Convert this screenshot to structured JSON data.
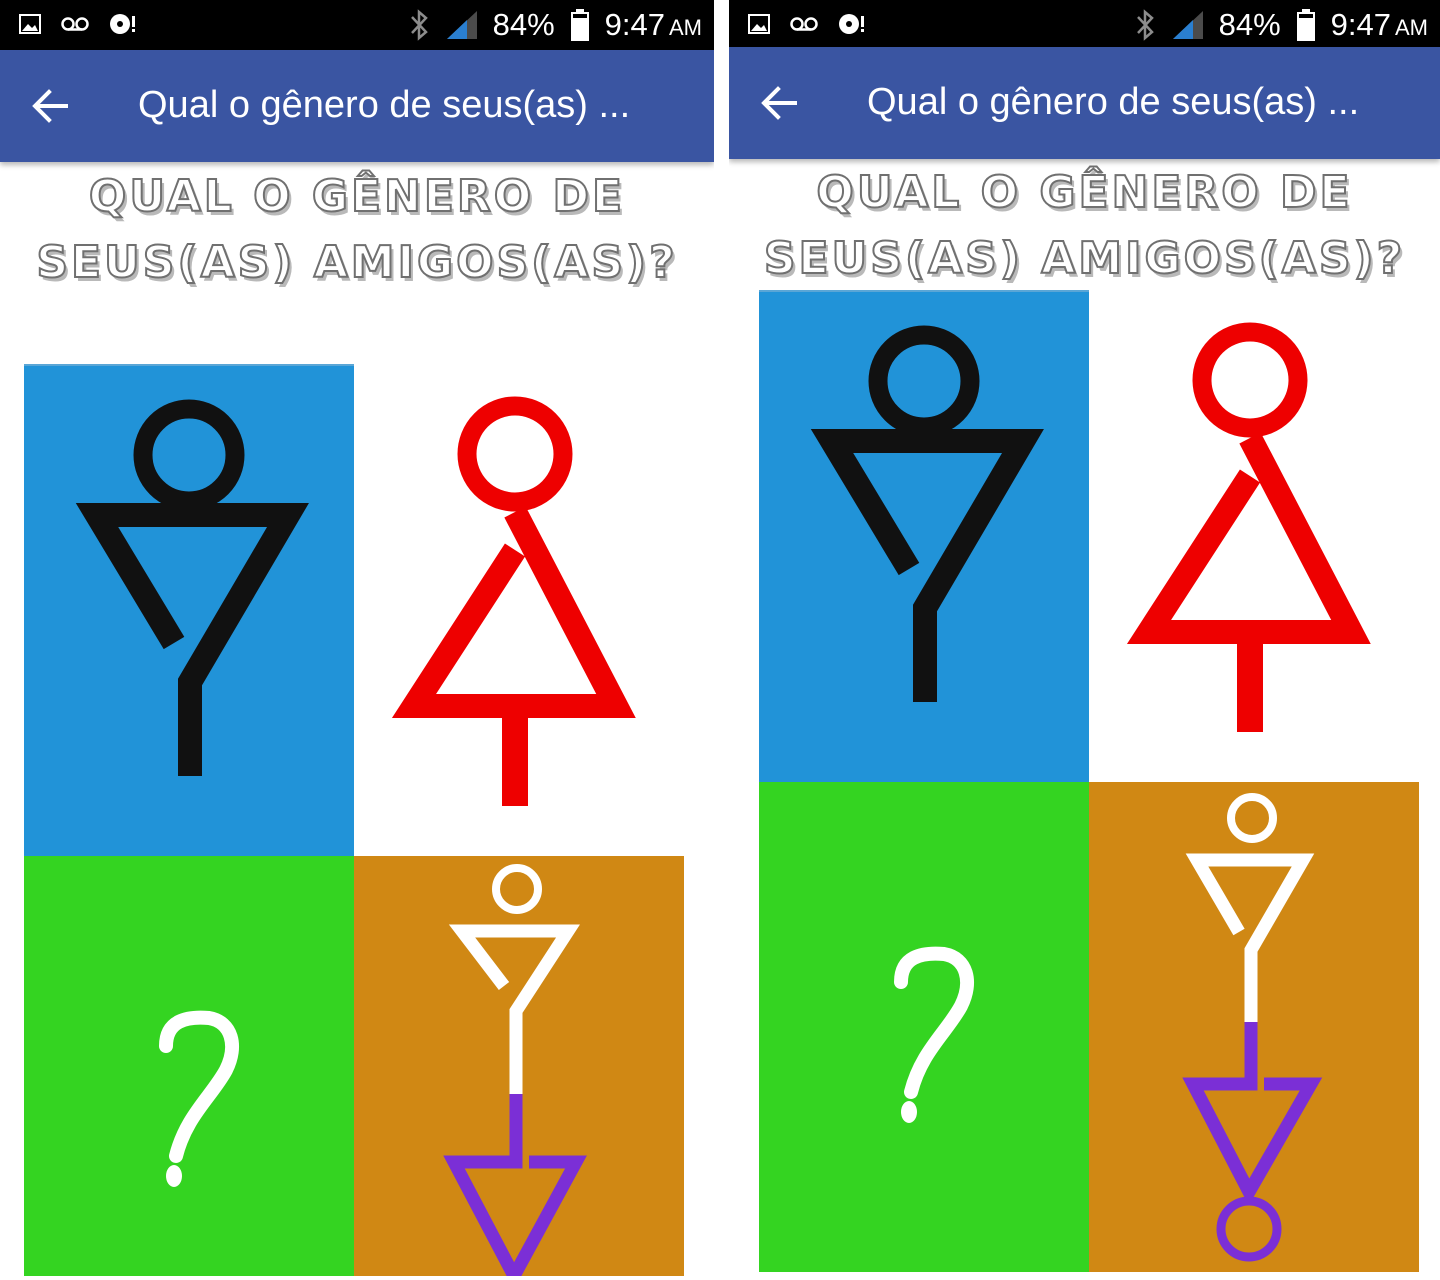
{
  "status_bar": {
    "battery": "84%",
    "time": "9:47",
    "ampm": "AM",
    "icons": [
      "image-icon",
      "voicemail-icon",
      "disc-alert-icon",
      "bluetooth-icon",
      "signal-icon",
      "battery-icon"
    ]
  },
  "app_bar": {
    "title": "Qual o gênero de seus(as) ...",
    "back_icon": "arrow-left-icon"
  },
  "question": {
    "line1": "QUAL O GÊNERO DE",
    "line2": "SEUS(AS) AMIGOS(AS)?"
  },
  "options": [
    {
      "name": "male-option",
      "icon": "male-symbol-icon",
      "background": "#2193d8"
    },
    {
      "name": "female-option",
      "icon": "female-symbol-icon",
      "background": "#ffffff"
    },
    {
      "name": "unknown-option",
      "icon": "question-mark-icon",
      "label": "?",
      "background": "#34d421"
    },
    {
      "name": "other-option",
      "icon": "combined-gender-symbol-icon",
      "background": "#d08814"
    }
  ],
  "colors": {
    "status_bar": "#000000",
    "app_bar": "#3a55a2",
    "male_figure": "#111111",
    "female_figure": "#ee0000",
    "other_purple": "#7b2fd6"
  }
}
